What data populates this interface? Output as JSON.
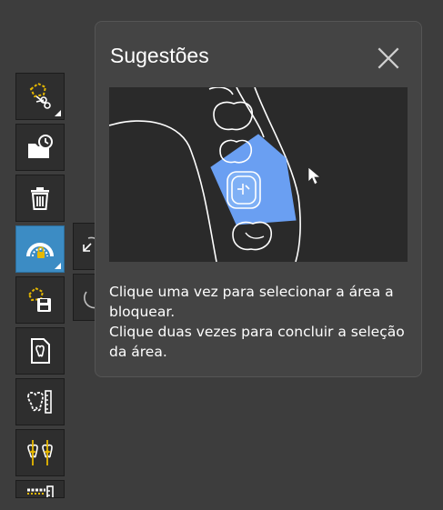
{
  "toolbar": {
    "tools": [
      {
        "name": "lasso-cut-icon",
        "has_submenu": true
      },
      {
        "name": "folder-history-icon",
        "has_submenu": false
      },
      {
        "name": "trash-icon",
        "has_submenu": false
      },
      {
        "name": "block-area-icon",
        "has_submenu": true,
        "active": true
      },
      {
        "name": "save-selection-icon",
        "has_submenu": false
      },
      {
        "name": "tooth-document-icon",
        "has_submenu": false
      },
      {
        "name": "tooth-measure-icon",
        "has_submenu": false
      },
      {
        "name": "tooth-alignment-icon",
        "has_submenu": false
      },
      {
        "name": "arch-measure-icon",
        "has_submenu": false
      }
    ]
  },
  "side_actions": [
    {
      "name": "undo-icon"
    },
    {
      "name": "redo-icon"
    }
  ],
  "tooltip": {
    "title": "Sugestões",
    "close_icon": "close-icon",
    "lines": [
      "Clique uma vez para selecionar a área a bloquear.",
      "Clique duas vezes para concluir a seleção da área."
    ]
  },
  "colors": {
    "background": "#3d3d3d",
    "panel": "#444444",
    "accent": "#3c8cc4",
    "selection": "#6a9ff2"
  }
}
